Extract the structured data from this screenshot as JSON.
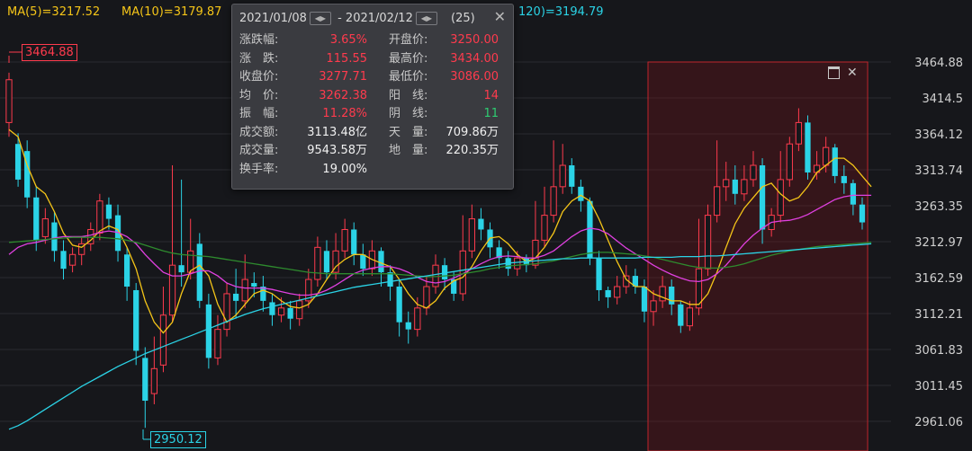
{
  "chart_data": {
    "type": "candlestick",
    "ma_legend": [
      {
        "label": "MA(5)=3217.52",
        "color": "#f5c518"
      },
      {
        "label": "MA(10)=3179.87",
        "color": "#f5c518"
      },
      {
        "label": "120)=3194.79",
        "color": "#2bd3e6"
      }
    ],
    "y_ticks": [
      "3464.88",
      "3414.5",
      "3364.12",
      "3313.74",
      "3263.35",
      "3212.97",
      "3162.59",
      "3112.21",
      "3061.83",
      "3011.45",
      "2961.06"
    ],
    "ylim": [
      2950,
      3475
    ],
    "high_marker": "3464.88",
    "low_marker": "2950.12",
    "candles": [
      [
        3380,
        3440,
        3360,
        3450
      ],
      [
        3350,
        3300,
        3290,
        3365
      ],
      [
        3340,
        3275,
        3260,
        3355
      ],
      [
        3275,
        3215,
        3200,
        3290
      ],
      [
        3220,
        3245,
        3210,
        3260
      ],
      [
        3240,
        3200,
        3185,
        3255
      ],
      [
        3200,
        3175,
        3160,
        3215
      ],
      [
        3180,
        3195,
        3170,
        3205
      ],
      [
        3195,
        3210,
        3180,
        3220
      ],
      [
        3210,
        3230,
        3200,
        3240
      ],
      [
        3225,
        3270,
        3215,
        3280
      ],
      [
        3265,
        3245,
        3230,
        3275
      ],
      [
        3250,
        3200,
        3185,
        3265
      ],
      [
        3195,
        3150,
        3130,
        3205
      ],
      [
        3145,
        3060,
        3040,
        3155
      ],
      [
        3050,
        2990,
        2952,
        3065
      ],
      [
        3000,
        3035,
        2985,
        3080
      ],
      [
        3040,
        3110,
        3030,
        3150
      ],
      [
        3110,
        3180,
        3100,
        3320
      ],
      [
        3180,
        3170,
        3150,
        3300
      ],
      [
        3170,
        3200,
        3160,
        3245
      ],
      [
        3210,
        3130,
        3120,
        3225
      ],
      [
        3125,
        3050,
        3035,
        3140
      ],
      [
        3050,
        3090,
        3040,
        3110
      ],
      [
        3090,
        3140,
        3080,
        3155
      ],
      [
        3140,
        3130,
        3105,
        3175
      ],
      [
        3130,
        3160,
        3120,
        3195
      ],
      [
        3155,
        3150,
        3135,
        3170
      ],
      [
        3150,
        3130,
        3115,
        3165
      ],
      [
        3128,
        3110,
        3095,
        3140
      ],
      [
        3110,
        3120,
        3100,
        3135
      ],
      [
        3120,
        3105,
        3090,
        3130
      ],
      [
        3105,
        3130,
        3095,
        3140
      ],
      [
        3130,
        3160,
        3120,
        3175
      ],
      [
        3160,
        3205,
        3150,
        3220
      ],
      [
        3200,
        3170,
        3160,
        3215
      ],
      [
        3170,
        3200,
        3160,
        3225
      ],
      [
        3200,
        3230,
        3190,
        3245
      ],
      [
        3230,
        3195,
        3180,
        3240
      ],
      [
        3195,
        3175,
        3165,
        3210
      ],
      [
        3175,
        3200,
        3165,
        3215
      ],
      [
        3200,
        3170,
        3150,
        3205
      ],
      [
        3170,
        3150,
        3130,
        3180
      ],
      [
        3150,
        3100,
        3080,
        3160
      ],
      [
        3100,
        3090,
        3070,
        3115
      ],
      [
        3090,
        3120,
        3080,
        3135
      ],
      [
        3120,
        3150,
        3110,
        3165
      ],
      [
        3150,
        3180,
        3140,
        3195
      ],
      [
        3180,
        3160,
        3145,
        3190
      ],
      [
        3160,
        3140,
        3130,
        3170
      ],
      [
        3140,
        3200,
        3130,
        3250
      ],
      [
        3200,
        3245,
        3190,
        3265
      ],
      [
        3245,
        3230,
        3215,
        3260
      ],
      [
        3230,
        3205,
        3190,
        3240
      ],
      [
        3205,
        3190,
        3175,
        3215
      ],
      [
        3190,
        3175,
        3165,
        3200
      ],
      [
        3175,
        3190,
        3165,
        3200
      ],
      [
        3190,
        3180,
        3170,
        3195
      ],
      [
        3180,
        3215,
        3175,
        3270
      ],
      [
        3215,
        3250,
        3205,
        3290
      ],
      [
        3250,
        3290,
        3240,
        3355
      ],
      [
        3290,
        3320,
        3280,
        3350
      ],
      [
        3320,
        3290,
        3280,
        3330
      ],
      [
        3290,
        3270,
        3255,
        3300
      ],
      [
        3270,
        3190,
        3180,
        3275
      ],
      [
        3190,
        3145,
        3130,
        3200
      ],
      [
        3145,
        3135,
        3120,
        3150
      ],
      [
        3135,
        3150,
        3125,
        3165
      ],
      [
        3150,
        3165,
        3140,
        3180
      ],
      [
        3165,
        3150,
        3140,
        3175
      ],
      [
        3150,
        3115,
        3100,
        3160
      ],
      [
        3115,
        3130,
        3095,
        3145
      ],
      [
        3130,
        3150,
        3120,
        3165
      ],
      [
        3150,
        3125,
        3110,
        3160
      ],
      [
        3125,
        3095,
        3085,
        3130
      ],
      [
        3095,
        3120,
        3088,
        3130
      ],
      [
        3120,
        3175,
        3110,
        3245
      ],
      [
        3175,
        3250,
        3165,
        3265
      ],
      [
        3250,
        3290,
        3240,
        3355
      ],
      [
        3290,
        3300,
        3270,
        3325
      ],
      [
        3300,
        3280,
        3265,
        3320
      ],
      [
        3280,
        3300,
        3270,
        3320
      ],
      [
        3300,
        3320,
        3290,
        3340
      ],
      [
        3320,
        3230,
        3210,
        3330
      ],
      [
        3230,
        3250,
        3220,
        3260
      ],
      [
        3250,
        3300,
        3240,
        3340
      ],
      [
        3300,
        3350,
        3290,
        3360
      ],
      [
        3350,
        3380,
        3340,
        3400
      ],
      [
        3380,
        3310,
        3300,
        3390
      ],
      [
        3310,
        3320,
        3300,
        3340
      ],
      [
        3320,
        3345,
        3310,
        3360
      ],
      [
        3345,
        3305,
        3295,
        3350
      ],
      [
        3305,
        3295,
        3280,
        3320
      ],
      [
        3295,
        3265,
        3250,
        3300
      ],
      [
        3265,
        3240,
        3230,
        3275
      ]
    ],
    "overlay_ma": [
      {
        "name": "",
        "color": "#f5c518",
        "values": [
          3370,
          3360,
          3320,
          3290,
          3280,
          3255,
          3225,
          3208,
          3205,
          3215,
          3228,
          3235,
          3230,
          3205,
          3175,
          3130,
          3100,
          3085,
          3100,
          3140,
          3172,
          3180,
          3165,
          3125,
          3100,
          3110,
          3125,
          3140,
          3145,
          3140,
          3130,
          3122,
          3120,
          3125,
          3140,
          3160,
          3178,
          3188,
          3195,
          3195,
          3188,
          3183,
          3178,
          3160,
          3140,
          3125,
          3120,
          3130,
          3148,
          3158,
          3163,
          3178,
          3200,
          3218,
          3220,
          3210,
          3195,
          3185,
          3190,
          3205,
          3225,
          3255,
          3270,
          3278,
          3270,
          3245,
          3215,
          3185,
          3160,
          3150,
          3150,
          3140,
          3135,
          3130,
          3130,
          3125,
          3125,
          3140,
          3170,
          3205,
          3238,
          3260,
          3275,
          3290,
          3295,
          3280,
          3270,
          3275,
          3290,
          3310,
          3320,
          3330,
          3330,
          3320,
          3305,
          3290
        ]
      },
      {
        "name": "",
        "color": "#e040e0",
        "values": [
          3195,
          3205,
          3210,
          3212,
          3215,
          3218,
          3220,
          3220,
          3220,
          3222,
          3226,
          3228,
          3226,
          3220,
          3210,
          3195,
          3182,
          3170,
          3165,
          3165,
          3168,
          3172,
          3172,
          3165,
          3155,
          3150,
          3148,
          3148,
          3148,
          3146,
          3143,
          3140,
          3138,
          3138,
          3140,
          3145,
          3152,
          3160,
          3168,
          3173,
          3176,
          3178,
          3178,
          3175,
          3170,
          3163,
          3157,
          3155,
          3157,
          3162,
          3168,
          3175,
          3182,
          3188,
          3192,
          3193,
          3192,
          3190,
          3190,
          3194,
          3200,
          3210,
          3220,
          3228,
          3232,
          3230,
          3224,
          3214,
          3204,
          3196,
          3188,
          3180,
          3173,
          3167,
          3162,
          3158,
          3157,
          3160,
          3168,
          3180,
          3195,
          3210,
          3222,
          3232,
          3240,
          3242,
          3243,
          3246,
          3251,
          3258,
          3265,
          3272,
          3276,
          3278,
          3278,
          3278
        ]
      },
      {
        "name": "",
        "color": "#2e8b2e",
        "values": [
          3212,
          3213,
          3214,
          3215,
          3216,
          3217,
          3218,
          3219,
          3219,
          3219,
          3219,
          3218,
          3217,
          3215,
          3212,
          3208,
          3204,
          3200,
          3197,
          3195,
          3194,
          3193,
          3192,
          3190,
          3188,
          3186,
          3184,
          3182,
          3180,
          3178,
          3176,
          3174,
          3172,
          3170,
          3169,
          3168,
          3168,
          3168,
          3168,
          3168,
          3168,
          3168,
          3168,
          3167,
          3166,
          3165,
          3164,
          3164,
          3165,
          3166,
          3168,
          3170,
          3172,
          3175,
          3177,
          3179,
          3180,
          3181,
          3182,
          3184,
          3186,
          3189,
          3192,
          3195,
          3197,
          3198,
          3198,
          3197,
          3196,
          3195,
          3193,
          3191,
          3188,
          3185,
          3182,
          3179,
          3177,
          3176,
          3176,
          3177,
          3179,
          3182,
          3186,
          3190,
          3194,
          3197,
          3200,
          3202,
          3204,
          3206,
          3207,
          3208,
          3209,
          3210,
          3211,
          3212
        ]
      },
      {
        "name": "",
        "color": "#2bd3e6",
        "values": [
          2950,
          2955,
          2962,
          2970,
          2978,
          2986,
          2994,
          3002,
          3010,
          3017,
          3024,
          3031,
          3038,
          3044,
          3050,
          3056,
          3061,
          3066,
          3071,
          3076,
          3081,
          3086,
          3091,
          3096,
          3101,
          3106,
          3111,
          3115,
          3119,
          3122,
          3125,
          3128,
          3131,
          3134,
          3137,
          3140,
          3143,
          3146,
          3149,
          3151,
          3153,
          3155,
          3157,
          3159,
          3161,
          3163,
          3165,
          3167,
          3169,
          3171,
          3173,
          3175,
          3177,
          3179,
          3181,
          3183,
          3184,
          3185,
          3186,
          3187,
          3188,
          3189,
          3189,
          3190,
          3190,
          3190,
          3190,
          3190,
          3190,
          3190,
          3191,
          3191,
          3191,
          3191,
          3192,
          3192,
          3192,
          3193,
          3193,
          3194,
          3195,
          3196,
          3197,
          3198,
          3199,
          3200,
          3201,
          3202,
          3203,
          3204,
          3205,
          3206,
          3207,
          3208,
          3209,
          3210
        ]
      }
    ],
    "selected_range": {
      "start_index": 71,
      "end_index": 94
    }
  },
  "popup": {
    "date_start": "2021/01/08",
    "date_sep": "-",
    "date_end": "2021/02/12",
    "count": "(25)",
    "rows": [
      {
        "l1": "涨跌幅:",
        "v1": "3.65%",
        "c1": "red",
        "l2": "开盘价:",
        "v2": "3250.00",
        "c2": "red"
      },
      {
        "l1": "涨　跌:",
        "v1": "115.55",
        "c1": "red",
        "l2": "最高价:",
        "v2": "3434.00",
        "c2": "red"
      },
      {
        "l1": "收盘价:",
        "v1": "3277.71",
        "c1": "red",
        "l2": "最低价:",
        "v2": "3086.00",
        "c2": "red"
      },
      {
        "l1": "均　价:",
        "v1": "3262.38",
        "c1": "red",
        "l2": "阳　线:",
        "v2": "14",
        "c2": "red"
      },
      {
        "l1": "振　幅:",
        "v1": "11.28%",
        "c1": "red",
        "l2": "阴　线:",
        "v2": "11",
        "c2": "green"
      },
      {
        "l1": "成交额:",
        "v1": "3113.48亿",
        "c1": "white",
        "l2": "天　量:",
        "v2": "709.86万",
        "c2": "white"
      },
      {
        "l1": "成交量:",
        "v1": "9543.58万",
        "c1": "white",
        "l2": "地　量:",
        "v2": "220.35万",
        "c2": "white"
      },
      {
        "l1": "换手率:",
        "v1": "19.00%",
        "c1": "white",
        "l2": "",
        "v2": "",
        "c2": "white"
      }
    ]
  },
  "colors": {
    "up": "#ff3b4d",
    "down": "#2bd3e6",
    "grid": "#2a2b30",
    "axis_text": "#d0d0d0"
  }
}
